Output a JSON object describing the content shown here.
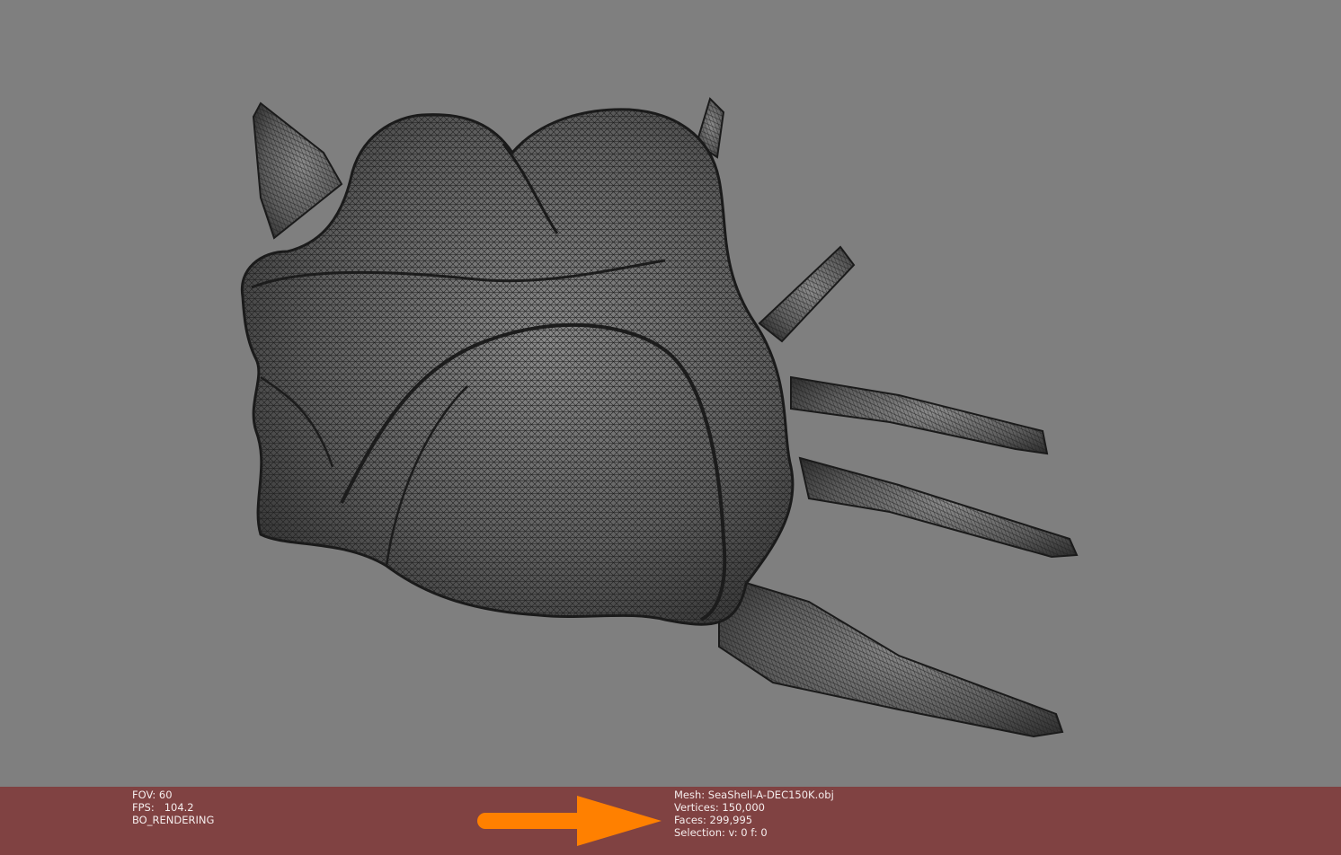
{
  "viewport": {
    "background_color": "#7f7f7f",
    "mesh_fill_color": "#5a5a5a",
    "wire_color": "#1c1c1c",
    "object": "seashell-wireframe-mesh"
  },
  "status_left": {
    "fov": "FOV: 60",
    "fps": "FPS:   104.2",
    "mode": "BO_RENDERING"
  },
  "status_right": {
    "mesh": "Mesh: SeaShell-A-DEC150K.obj",
    "vertices": "Vertices: 150,000",
    "faces": "Faces: 299,995",
    "selection": "Selection: v: 0 f: 0"
  },
  "info_bar": {
    "background_color": "#804242",
    "arrow_color": "#ff8000",
    "arrow_icon": "arrow-right-icon"
  }
}
